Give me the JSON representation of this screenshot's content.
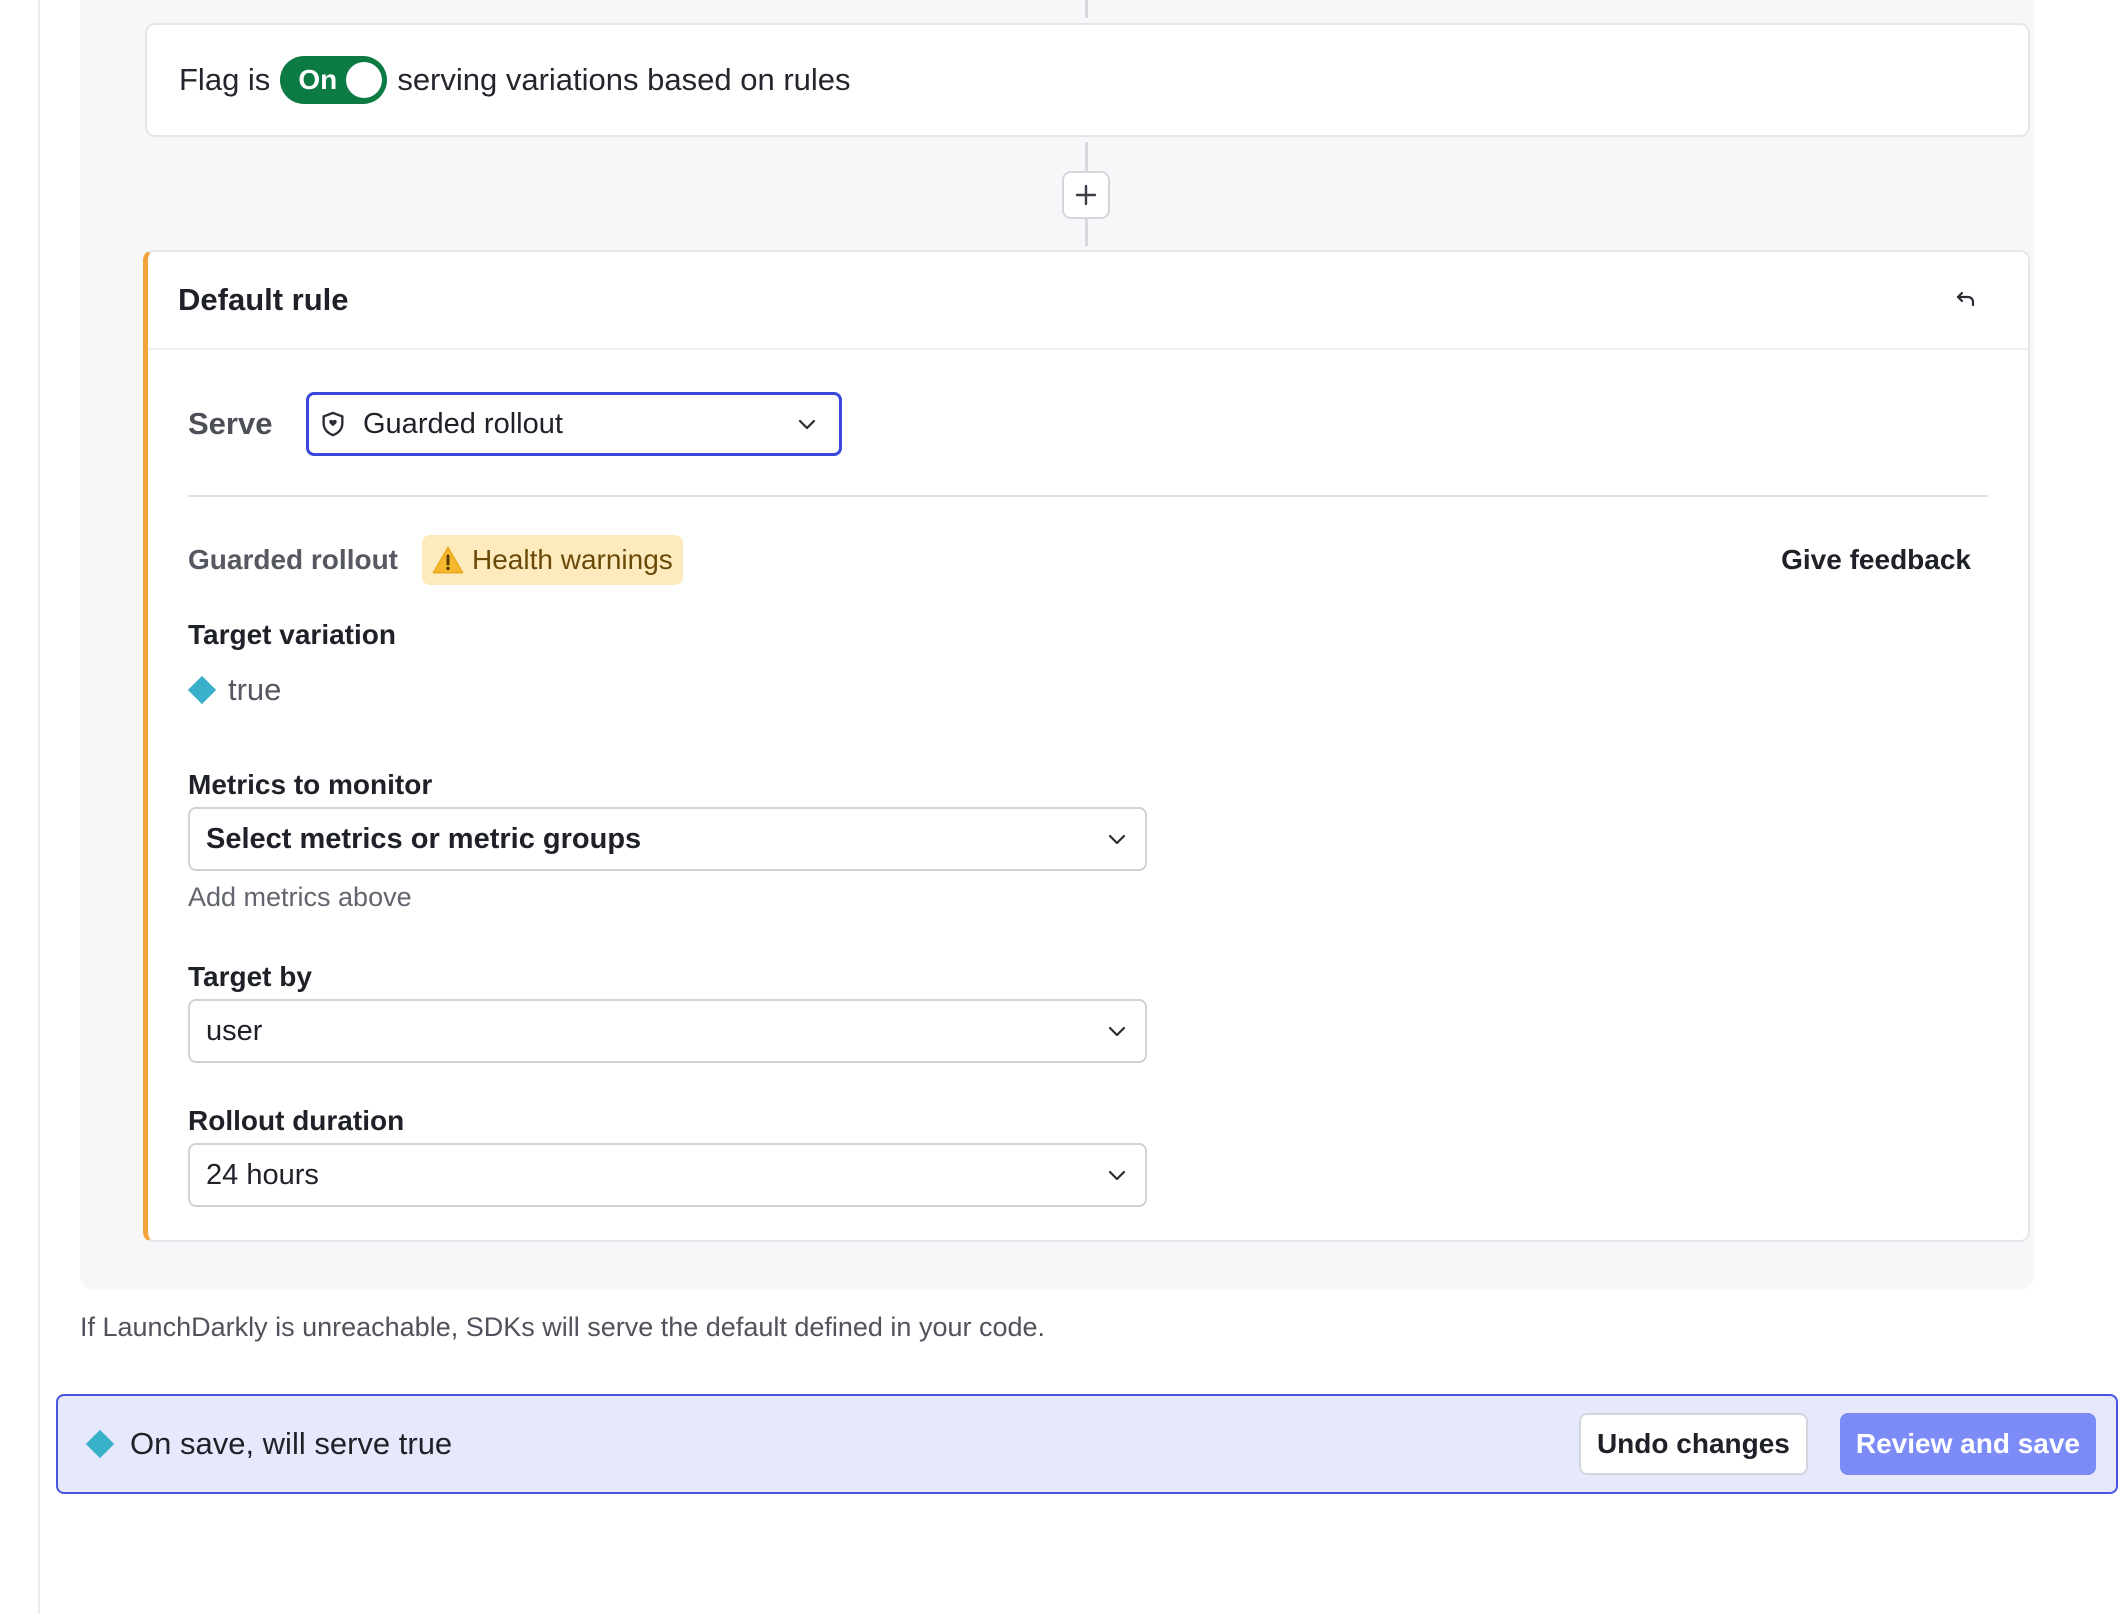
{
  "flag_status": {
    "prefix": "Flag is",
    "toggle_label": "On",
    "suffix": "serving variations based on rules"
  },
  "add_rule_icon": "plus-icon",
  "default_rule": {
    "title": "Default rule",
    "reset_icon": "undo-arrow-icon",
    "serve": {
      "label": "Serve",
      "selected": "Guarded rollout",
      "icon": "shield-icon"
    },
    "guarded_rollout": {
      "label": "Guarded rollout",
      "badge": "Health warnings",
      "badge_icon": "warning-triangle-icon",
      "feedback_link": "Give feedback"
    },
    "target_variation": {
      "label": "Target variation",
      "value": "true",
      "color": "#3ab1cb"
    },
    "metrics": {
      "label": "Metrics to monitor",
      "placeholder": "Select metrics or metric groups",
      "helper": "Add metrics above"
    },
    "target_by": {
      "label": "Target by",
      "value": "user"
    },
    "rollout_duration": {
      "label": "Rollout duration",
      "value": "24 hours"
    }
  },
  "footer_note": "If LaunchDarkly is unreachable, SDKs will serve the default defined in your code.",
  "save_bar": {
    "message": "On save, will serve true",
    "undo_label": "Undo changes",
    "review_label": "Review and save"
  },
  "colors": {
    "toggle_on": "#0b7a43",
    "rule_accent": "#f2a33a",
    "select_focus": "#3b47d9",
    "primary_button": "#7d8bf7",
    "warning_bg": "#fdebbd"
  }
}
